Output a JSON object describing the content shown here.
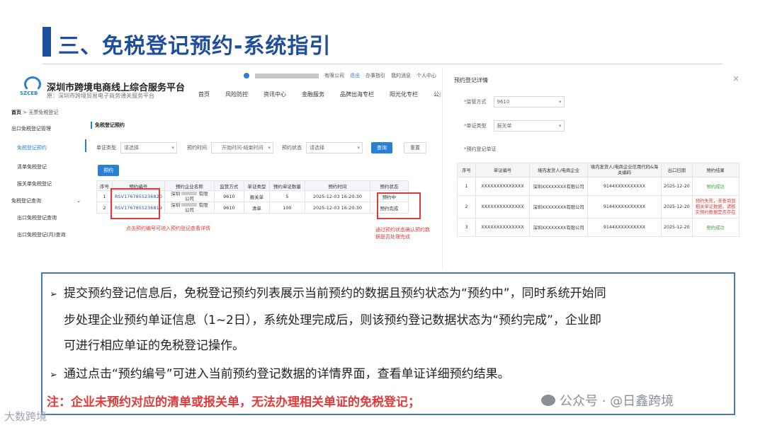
{
  "slide": {
    "title": "三、免税登记预约-系统指引"
  },
  "portal": {
    "logo_text": "SZCEB",
    "name": "深圳市跨境电商线上综合服务平台",
    "subtitle": "原：深圳市跨境贸易电子商务通关服务平台",
    "user_suffix": "有限公司",
    "logout": "退出",
    "links": [
      "办事指引",
      "我的消息",
      "个人中心"
    ],
    "nav": [
      "首页",
      "风险防控",
      "资讯中心",
      "金融服务",
      "品牌出海专栏",
      "阳光化专栏",
      "公共查询"
    ]
  },
  "breadcrumb": {
    "home": "首页",
    "separator": ">",
    "current": "无票免税登记"
  },
  "sidebar": {
    "items": [
      {
        "label": "出口免税登记管理"
      },
      {
        "label": "免税登记预约"
      },
      {
        "label": "清单免税登记"
      },
      {
        "label": "报关单免税登记"
      },
      {
        "label": "免税登记查询"
      },
      {
        "label": "出口免税登记查询"
      },
      {
        "label": "出口免税登记(月)查询"
      }
    ],
    "expand_icon": "⌄"
  },
  "content": {
    "section_title": "免税登记预约",
    "filters": {
      "doc_type_label": "单证类型",
      "doc_type_value": "请选择",
      "time_label": "预约时间",
      "time_placeholder": "开始时间-结束时间",
      "status_label": "预约状态",
      "status_value": "请选择",
      "query": "查询",
      "reset": "重置"
    },
    "reserve_button": "预约",
    "table": {
      "headers": [
        "序号",
        "预约编号",
        "预约企业名称",
        "监管方式",
        "单证类型",
        "预约单证数量",
        "预约时间",
        "预约状态"
      ],
      "rows": [
        {
          "no": "1",
          "code": "RSV1767855236820",
          "company_a": "深圳",
          "company_b": "有限",
          "company_c": "公司",
          "mode": "9610",
          "doc": "报关单",
          "qty": "5",
          "time": "2025-12-03 16:20:30",
          "status": "预约中"
        },
        {
          "no": "2",
          "code": "RSV1767855236819",
          "company_a": "深圳",
          "company_b": "有限",
          "company_c": "公司",
          "mode": "9610",
          "doc": "清单",
          "qty": "100",
          "time": "2025-12-03 16:20:30",
          "status": "预约完成"
        }
      ]
    },
    "note_code": "点击预约编号可进入预约登记查看详情",
    "note_status_1": "通过预约状态确认预约数",
    "note_status_2": "据是否处理完成"
  },
  "detail": {
    "title": "预约登记详情",
    "close": "×",
    "mode_label": "监管方式",
    "mode_value": "9610",
    "doc_label": "单证类型",
    "doc_value": "报关单",
    "section": "预约登记单证",
    "req_mark": "*",
    "table": {
      "headers": [
        "序号",
        "单证编号",
        "境内发货人/电商企业",
        "境内发货人/电商企业信用代码&海关编码",
        "出口日期",
        "预约结果"
      ],
      "header_code_1": "境内发货人/电商企业信用代码&海",
      "header_code_2": "关编码",
      "rows": [
        {
          "no": "1",
          "doc_no": "XXXXXXXXXXXXXX",
          "company": "深圳XXXXXXXX有限公司",
          "code": "9144XXXXXXXXXX",
          "date": "2025-12-20",
          "result": "预约成功"
        },
        {
          "no": "2",
          "doc_no": "XXXXXXXXXXXXXX",
          "company": "深圳XXXXXXXX有限公司",
          "code": "9144XXXXXXXXXX",
          "date": "2025-12-20",
          "result_1": "预约失败，未查询到",
          "result_2": "相关单证数据，请核",
          "result_3": "实预约数据是否存在"
        },
        {
          "no": "3",
          "doc_no": "XXXXXXXXXXXXXX",
          "company": "深圳XXXXXXXX有限公司",
          "code": "9144XXXXXXXXXX",
          "date": "2025-12-20",
          "result": "预约成功"
        }
      ]
    }
  },
  "explanation": {
    "arrow": "➢",
    "bullet1_line1": "提交预约登记信息后，免税登记预约列表展示当前预约的数据且预约状态为“预约中”，同时系统开始同",
    "bullet1_line2": "步处理企业预约单证信息（1~2日），系统处理完成后，则该预约登记数据状态为“预约完成”，企业即",
    "bullet1_line3": "可进行相应单证的免税登记操作。",
    "bullet2": "通过点击“预约编号”可进入当前预约登记数据的详情界面，查看单证详细预约结果。",
    "note": "注：企业未预约对应的清单或报关单，无法办理相关单证的免税登记；"
  },
  "watermarks": {
    "left": "大数跨境",
    "right_1": "公众号 · @日鑫跨境"
  },
  "colors": {
    "brand_blue": "#1f4e9c",
    "link_blue": "#2a7fd4",
    "alert_red": "#e03a3a",
    "success_green": "#3aa13a"
  }
}
